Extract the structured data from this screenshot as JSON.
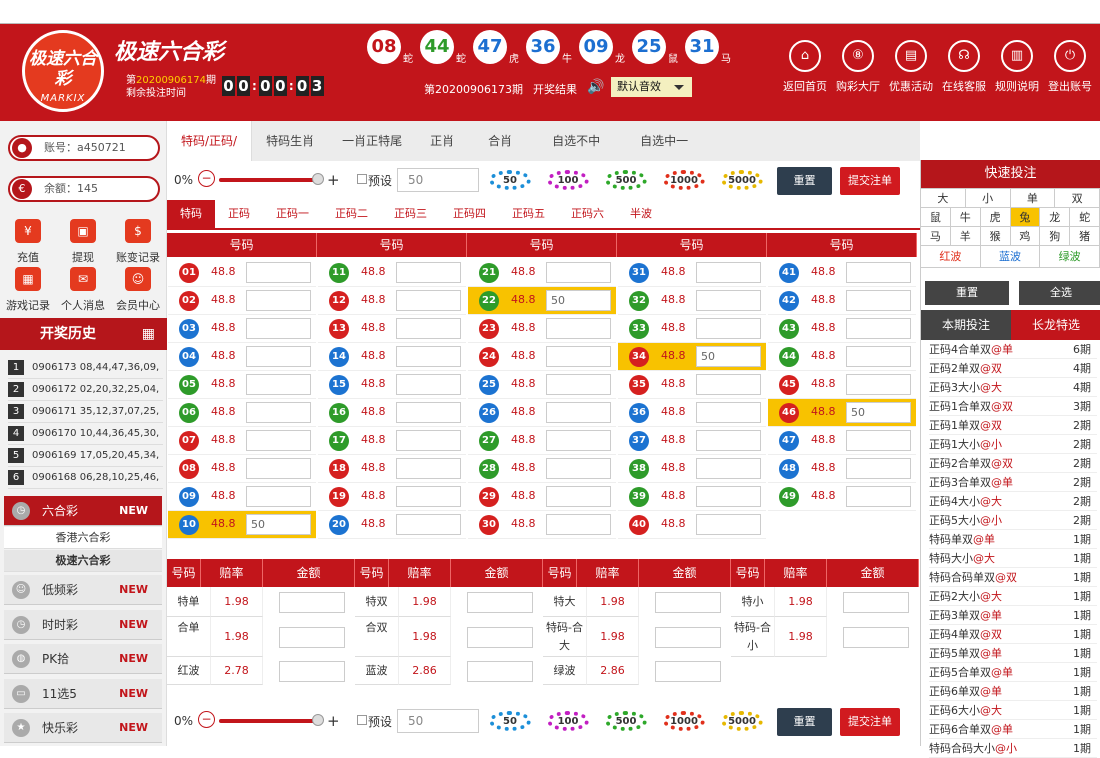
{
  "header": {
    "logo_text": "极速六合彩",
    "logo_sub": "MARKIX",
    "title": "极速六合彩",
    "period_prefix": "第",
    "period_no": "20200906174",
    "period_suffix": "期",
    "countdown_label": "剩余投注时间",
    "timer": [
      "0",
      "0",
      "0",
      "0",
      "0",
      "3"
    ],
    "balls": [
      {
        "n": "08",
        "z": "蛇",
        "c": "#c2151b"
      },
      {
        "n": "44",
        "z": "蛇",
        "c": "#2e9b2a"
      },
      {
        "n": "47",
        "z": "虎",
        "c": "#1c6fd1"
      },
      {
        "n": "36",
        "z": "牛",
        "c": "#1c6fd1"
      },
      {
        "n": "09",
        "z": "龙",
        "c": "#1c6fd1"
      },
      {
        "n": "25",
        "z": "鼠",
        "c": "#1c6fd1"
      },
      {
        "n": "31",
        "z": "马",
        "c": "#1c6fd1"
      }
    ],
    "last_period": "第20200906173期",
    "result_label": "开奖结果",
    "sound_select": "默认音效",
    "nav": [
      {
        "label": "返回首页",
        "icon": "home-icon",
        "g": "⌂"
      },
      {
        "label": "购彩大厅",
        "icon": "lottery-ball-icon",
        "g": "⑧"
      },
      {
        "label": "优惠活动",
        "icon": "gift-icon",
        "g": "▤"
      },
      {
        "label": "在线客服",
        "icon": "headset-icon",
        "g": "☊"
      },
      {
        "label": "规则说明",
        "icon": "document-icon",
        "g": "▥"
      },
      {
        "label": "登出账号",
        "icon": "power-icon",
        "g": "⏻"
      }
    ]
  },
  "sidebar": {
    "account": "账号：a450721",
    "balance": "余额：145",
    "menu": [
      {
        "label": "充值",
        "icon": "yen-icon",
        "g": "¥"
      },
      {
        "label": "提现",
        "icon": "wallet-icon",
        "g": "▣"
      },
      {
        "label": "账变记录",
        "icon": "ledger-icon",
        "g": "$"
      },
      {
        "label": "游戏记录",
        "icon": "records-icon",
        "g": "▦"
      },
      {
        "label": "个人消息",
        "icon": "message-icon",
        "g": "✉"
      },
      {
        "label": "会员中心",
        "icon": "user-icon",
        "g": "☺"
      }
    ],
    "history_title": "开奖历史",
    "history": [
      {
        "i": "1",
        "t": "0906173  08,44,47,36,09,"
      },
      {
        "i": "2",
        "t": "0906172  02,20,32,25,04,"
      },
      {
        "i": "3",
        "t": "0906171  35,12,37,07,25,"
      },
      {
        "i": "4",
        "t": "0906170  10,44,36,45,30,"
      },
      {
        "i": "5",
        "t": "0906169  17,05,20,45,34,"
      },
      {
        "i": "6",
        "t": "0906168  06,28,10,25,46,"
      }
    ],
    "lotteries": [
      {
        "label": "六合彩",
        "new": "NEW",
        "icon": "clock-icon",
        "g": "◷"
      },
      {
        "label": "低频彩",
        "new": "NEW",
        "icon": "smile-icon",
        "g": "☺"
      },
      {
        "label": "时时彩",
        "new": "NEW",
        "icon": "clock-icon",
        "g": "◷"
      },
      {
        "label": "PK拾",
        "new": "NEW",
        "icon": "ball-icon",
        "g": "◍"
      },
      {
        "label": "11选5",
        "new": "NEW",
        "icon": "car-icon",
        "g": "▭"
      },
      {
        "label": "快乐彩",
        "new": "NEW",
        "icon": "star-icon",
        "g": "★"
      }
    ],
    "sub_items": [
      "香港六合彩",
      "极速六合彩"
    ]
  },
  "tabs": [
    "特码/正码/",
    "特码生肖",
    "一肖正特尾",
    "正肖",
    "合肖",
    "自选不中",
    "自选中一"
  ],
  "controls": {
    "percent": "0%",
    "preset": "预设",
    "amount": "50",
    "chips": [
      {
        "v": "50",
        "c": "#1c8fd8"
      },
      {
        "v": "100",
        "c": "#c21fc2"
      },
      {
        "v": "500",
        "c": "#2ea82a"
      },
      {
        "v": "1000",
        "c": "#e0301c"
      },
      {
        "v": "5000",
        "c": "#e6b800"
      }
    ],
    "reset": "重置",
    "submit": "提交注单"
  },
  "subtabs": [
    "特码",
    "正码",
    "正码一",
    "正码二",
    "正码三",
    "正码四",
    "正码五",
    "正码六",
    "半波"
  ],
  "col_header": "号码",
  "odds": "48.8",
  "highlighted": {
    "10": "50",
    "22": "50",
    "34": "50",
    "46": "50"
  },
  "red_nums": [
    1,
    2,
    7,
    8,
    12,
    13,
    18,
    19,
    23,
    24,
    29,
    30,
    34,
    35,
    40,
    45,
    46
  ],
  "blue_nums": [
    3,
    4,
    9,
    10,
    14,
    15,
    20,
    25,
    26,
    31,
    36,
    37,
    41,
    42,
    47,
    48
  ],
  "green_nums": [
    5,
    6,
    11,
    16,
    17,
    21,
    22,
    27,
    28,
    32,
    33,
    38,
    39,
    43,
    44,
    49
  ],
  "bottom": {
    "heads": [
      "号码",
      "赔率",
      "金额"
    ],
    "rows": [
      [
        {
          "k": "特单",
          "v": "1.98"
        },
        {
          "k": "特双",
          "v": "1.98"
        },
        {
          "k": "特大",
          "v": "1.98"
        },
        {
          "k": "特小",
          "v": "1.98"
        }
      ],
      [
        {
          "k": "合单",
          "v": "1.98"
        },
        {
          "k": "合双",
          "v": "1.98"
        },
        {
          "k": "特码-合大",
          "v": "1.98"
        },
        {
          "k": "特码-合小",
          "v": "1.98"
        }
      ],
      [
        {
          "k": "红波",
          "v": "2.78"
        },
        {
          "k": "蓝波",
          "v": "2.86"
        },
        {
          "k": "绿波",
          "v": "2.86"
        }
      ]
    ]
  },
  "right": {
    "title": "快速投注",
    "row1": [
      "大",
      "小",
      "单",
      "双"
    ],
    "zodiac": [
      "鼠",
      "牛",
      "虎",
      "兔",
      "龙",
      "蛇",
      "马",
      "羊",
      "猴",
      "鸡",
      "狗",
      "猪"
    ],
    "zodiac_selected": "兔",
    "waves": [
      {
        "t": "红波",
        "c": "#e0301c"
      },
      {
        "t": "蓝波",
        "c": "#1c6fd1"
      },
      {
        "t": "绿波",
        "c": "#2e9b2a"
      }
    ],
    "reset": "重置",
    "select_all": "全选",
    "tab_current": "本期投注",
    "tab_long": "长龙特选",
    "long": [
      {
        "a": "正码4合单双",
        "b": "@单",
        "p": "6期"
      },
      {
        "a": "正码2单双",
        "b": "@双",
        "p": "4期"
      },
      {
        "a": "正码3大小",
        "b": "@大",
        "p": "4期"
      },
      {
        "a": "正码1合单双",
        "b": "@双",
        "p": "3期"
      },
      {
        "a": "正码1单双",
        "b": "@双",
        "p": "2期"
      },
      {
        "a": "正码1大小",
        "b": "@小",
        "p": "2期"
      },
      {
        "a": "正码2合单双",
        "b": "@双",
        "p": "2期"
      },
      {
        "a": "正码3合单双",
        "b": "@单",
        "p": "2期"
      },
      {
        "a": "正码4大小",
        "b": "@大",
        "p": "2期"
      },
      {
        "a": "正码5大小",
        "b": "@小",
        "p": "2期"
      },
      {
        "a": "特码单双",
        "b": "@单",
        "p": "1期"
      },
      {
        "a": "特码大小",
        "b": "@大",
        "p": "1期"
      },
      {
        "a": "特码合码单双",
        "b": "@双",
        "p": "1期"
      },
      {
        "a": "正码2大小",
        "b": "@大",
        "p": "1期"
      },
      {
        "a": "正码3单双",
        "b": "@单",
        "p": "1期"
      },
      {
        "a": "正码4单双",
        "b": "@双",
        "p": "1期"
      },
      {
        "a": "正码5单双",
        "b": "@单",
        "p": "1期"
      },
      {
        "a": "正码5合单双",
        "b": "@单",
        "p": "1期"
      },
      {
        "a": "正码6单双",
        "b": "@单",
        "p": "1期"
      },
      {
        "a": "正码6大小",
        "b": "@大",
        "p": "1期"
      },
      {
        "a": "正码6合单双",
        "b": "@单",
        "p": "1期"
      },
      {
        "a": "特码合码大小",
        "b": "@小",
        "p": "1期"
      }
    ]
  }
}
